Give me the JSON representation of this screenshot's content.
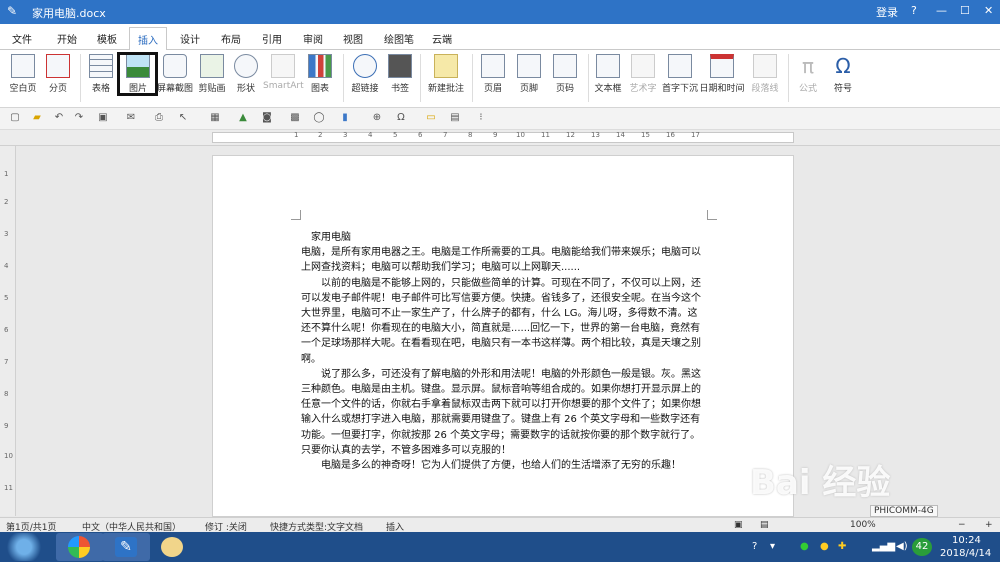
{
  "window": {
    "title": "家用电脑.docx",
    "login": "登录",
    "help": "?",
    "minimize": "—",
    "maximize": "☐",
    "close": "✕"
  },
  "ribbon_tabs": [
    {
      "label": "文件"
    },
    {
      "label": "开始"
    },
    {
      "label": "模板"
    },
    {
      "label": "插入",
      "active": true
    },
    {
      "label": "设计"
    },
    {
      "label": "布局"
    },
    {
      "label": "引用"
    },
    {
      "label": "审阅"
    },
    {
      "label": "视图"
    },
    {
      "label": "绘图笔"
    },
    {
      "label": "云端"
    }
  ],
  "ribbon_buttons": [
    {
      "label": "空白页",
      "icon": "blank-page-icon"
    },
    {
      "label": "分页",
      "icon": "page-break-icon"
    },
    {
      "label": "表格",
      "icon": "table-icon"
    },
    {
      "label": "图片",
      "icon": "picture-icon"
    },
    {
      "label": "屏幕截图",
      "icon": "screenshot-icon"
    },
    {
      "label": "剪贴画",
      "icon": "clipart-icon"
    },
    {
      "label": "形状",
      "icon": "shape-icon"
    },
    {
      "label": "SmartArt",
      "icon": "smartart-icon",
      "disabled": true
    },
    {
      "label": "图表",
      "icon": "chart-icon"
    },
    {
      "label": "超链接",
      "icon": "hyperlink-icon"
    },
    {
      "label": "书签",
      "icon": "bookmark-icon"
    },
    {
      "label": "新建批注",
      "icon": "new-comment-icon"
    },
    {
      "label": "页眉",
      "icon": "header-icon"
    },
    {
      "label": "页脚",
      "icon": "footer-icon"
    },
    {
      "label": "页码",
      "icon": "page-number-icon"
    },
    {
      "label": "文本框",
      "icon": "textbox-icon"
    },
    {
      "label": "艺术字",
      "icon": "wordart-icon",
      "disabled": true
    },
    {
      "label": "首字下沉",
      "icon": "drop-cap-icon"
    },
    {
      "label": "日期和时间",
      "icon": "date-time-icon"
    },
    {
      "label": "段落线",
      "icon": "paragraph-line-icon",
      "disabled": true
    },
    {
      "label": "公式",
      "icon": "formula-icon",
      "disabled": true
    },
    {
      "label": "符号",
      "icon": "symbol-icon"
    }
  ],
  "document": {
    "title": "家用电脑",
    "paragraphs": [
      "电脑，是所有家用电器之王。电脑是工作所需要的工具。电脑能给我们带来娱乐；电脑可以上网查找资料；电脑可以帮助我们学习；电脑可以上网聊天......",
      "以前的电脑是不能够上网的，只能做些简单的计算。可现在不同了，不仅可以上网，还可以发电子邮件呢！电子邮件可比写信要方便。快捷。省钱多了，还很安全呢。在当今这个大世界里，电脑可不止一家生产了，什么牌子的都有，什么 LG。海儿呀，多得数不清。这还不算什么呢！你看现在的电脑大小，简直就是......回忆一下，世界的第一台电脑，竟然有一个足球场那样大呢。在看看现在吧，电脑只有一本书这样薄。两个相比较，真是天壤之别啊。",
      "说了那么多，可还没有了解电脑的外形和用法呢！电脑的外形颜色一般是银。灰。黑这三种颜色。电脑是由主机。键盘。显示屏。鼠标音响等组合成的。如果你想打开显示屏上的任意一个文件的话，你就右手拿着鼠标双击两下就可以打开你想要的那个文件了；如果你想输入什么或想打字进入电脑，那就需要用键盘了。键盘上有 26 个英文字母和一些数字还有功能。一但要打字，你就按那 26 个英文字母；需要数字的话就按你要的那个数字就行了。只要你认真的去学，不管多困难多可以克服的！",
      "电脑是多么的神奇呀！它为人们提供了方便，也给人们的生活增添了无穷的乐趣！"
    ]
  },
  "status": {
    "page": "第1页/共1页",
    "language": "中文（中华人民共和国）",
    "revision": "修订 :关闭",
    "shortcut": "快捷方式类型:文字文档",
    "insert": "插入",
    "zoom": "100%"
  },
  "network_popup": "PHICOMM-4G",
  "watermark": "Bai 经验",
  "taskbar": {
    "time": "10:24",
    "date": "2018/4/14",
    "badge": "42"
  }
}
